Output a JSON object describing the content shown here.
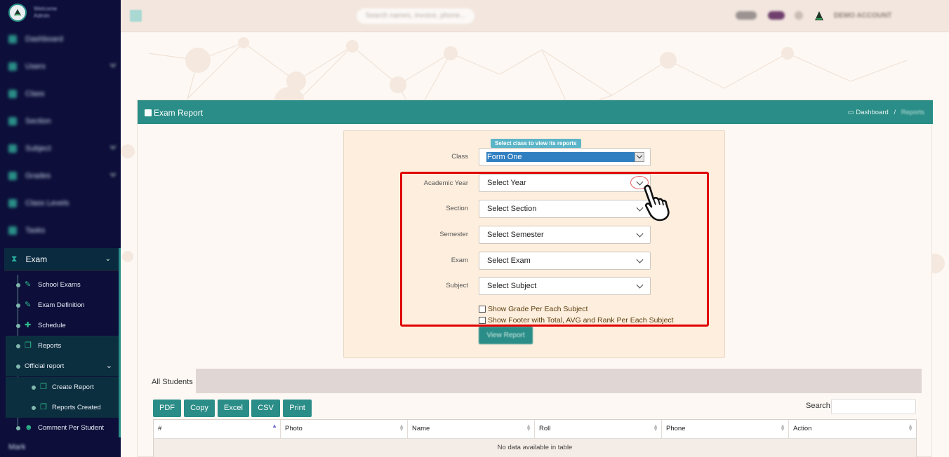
{
  "sidebar": {
    "welcome": "Welcome",
    "user": "Admin",
    "items": [
      {
        "label": "Dashboard"
      },
      {
        "label": "Users"
      },
      {
        "label": "Class"
      },
      {
        "label": "Section"
      },
      {
        "label": "Subject"
      },
      {
        "label": "Grades"
      },
      {
        "label": "Class Levels"
      },
      {
        "label": "Tasks"
      }
    ],
    "exam_label": "Exam",
    "exam_sub": [
      {
        "label": "School Exams"
      },
      {
        "label": "Exam Definition"
      },
      {
        "label": "Schedule"
      },
      {
        "label": "Reports"
      },
      {
        "label": "Official report"
      },
      {
        "label": "Create Report"
      },
      {
        "label": "Reports Created"
      },
      {
        "label": "Comment Per Student"
      }
    ],
    "bottom_label": "Mark"
  },
  "topbar": {
    "search_placeholder": "Search names, invoice, phone...",
    "account": "DEMO ACCOUNT"
  },
  "card": {
    "title": "Exam Report",
    "breadcrumb": {
      "home": "Dashboard",
      "current": "Reports"
    }
  },
  "form": {
    "hint": "Select class to view its reports",
    "class_label": "Class",
    "class_value": "Form One",
    "fields": [
      {
        "label": "Academic Year",
        "value": "Select Year"
      },
      {
        "label": "Section",
        "value": "Select Section"
      },
      {
        "label": "Semester",
        "value": "Select Semester"
      },
      {
        "label": "Exam",
        "value": "Select Exam"
      },
      {
        "label": "Subject",
        "value": "Select Subject"
      }
    ],
    "checkboxes": [
      {
        "label": "Show Grade Per Each Subject",
        "checked": false
      },
      {
        "label": "Show Footer with Total, AVG and Rank Per Each Subject",
        "checked": false
      }
    ],
    "submit": "View Report"
  },
  "table": {
    "tab": "All Students",
    "buttons": [
      "PDF",
      "Copy",
      "Excel",
      "CSV",
      "Print"
    ],
    "search_label": "Search:",
    "columns": [
      "#",
      "Photo",
      "Name",
      "Roll",
      "Phone",
      "Action"
    ],
    "empty": "No data available in table"
  },
  "colors": {
    "sidebar": "#0d0f3a",
    "accent": "#2a8d87",
    "highlight": "#e00000"
  }
}
